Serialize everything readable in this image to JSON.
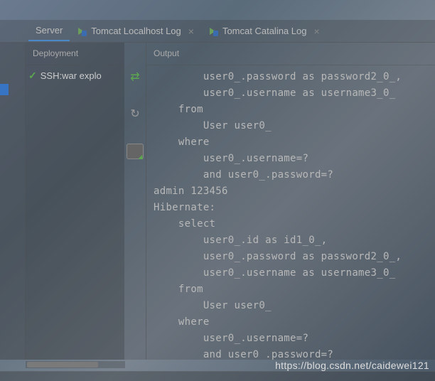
{
  "tabs": {
    "server": "Server",
    "tomcat_localhost": "Tomcat Localhost Log",
    "tomcat_catalina": "Tomcat Catalina Log"
  },
  "panels": {
    "deployment_header": "Deployment",
    "output_header": "Output"
  },
  "deployment": {
    "item_label": "SSH:war explo"
  },
  "output": {
    "text": "        user0_.password as password2_0_,\n        user0_.username as username3_0_ \n    from\n        User user0_ \n    where\n        user0_.username=? \n        and user0_.password=?\nadmin 123456\nHibernate: \n    select\n        user0_.id as id1_0_,\n        user0_.password as password2_0_,\n        user0_.username as username3_0_ \n    from\n        User user0_ \n    where\n        user0_.username=? \n        and user0_.password=?"
  },
  "watermark": "https://blog.csdn.net/caidewei121"
}
